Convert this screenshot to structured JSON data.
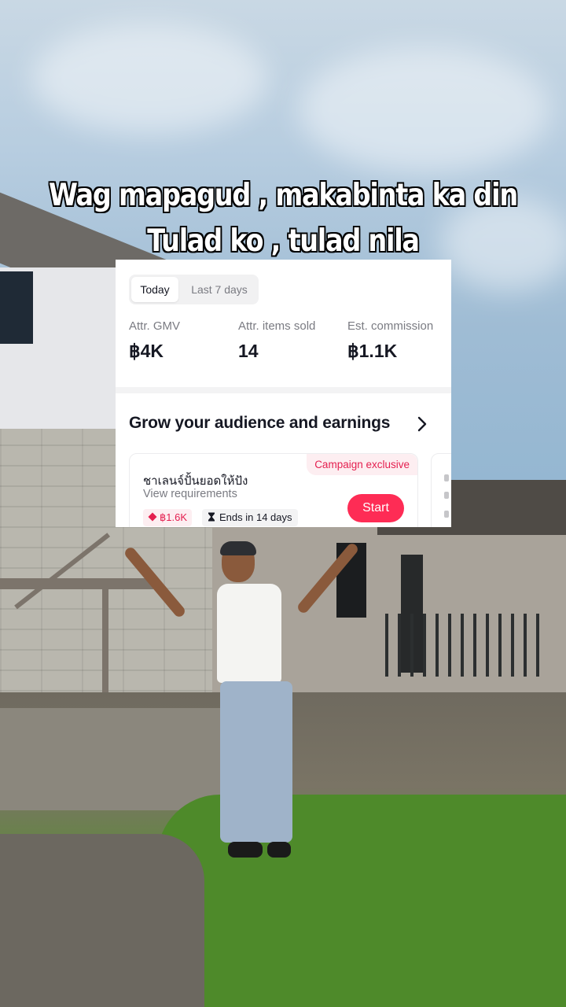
{
  "caption": {
    "line1": "Wag mapagud , makabinta ka din",
    "line2": "Tulad ko , tulad nila"
  },
  "tabs": {
    "today": "Today",
    "last7": "Last 7 days",
    "selected": "Today"
  },
  "metrics": [
    {
      "label": "Attr. GMV",
      "value": "฿4K"
    },
    {
      "label": "Attr. items sold",
      "value": "14"
    },
    {
      "label": "Est. commission",
      "value": "฿1.1K"
    }
  ],
  "grow": {
    "title": "Grow your audience and earnings"
  },
  "campaign": {
    "tag": "Campaign exclusive",
    "name": "ชาเลนจ์ปั้นยอดให้ปัง",
    "requirements": "View requirements",
    "reward": "฿1.6K",
    "ends": "Ends in 14 days",
    "start_label": "Start"
  },
  "colors": {
    "accent": "#fe2c55",
    "tag_bg": "#fdeef1",
    "tag_text": "#e41f4f",
    "text_primary": "#161823",
    "text_secondary": "#7a7b82"
  },
  "icons": {
    "more": "chevron-right-icon",
    "reward": "diamond-icon",
    "time": "hourglass-icon"
  }
}
